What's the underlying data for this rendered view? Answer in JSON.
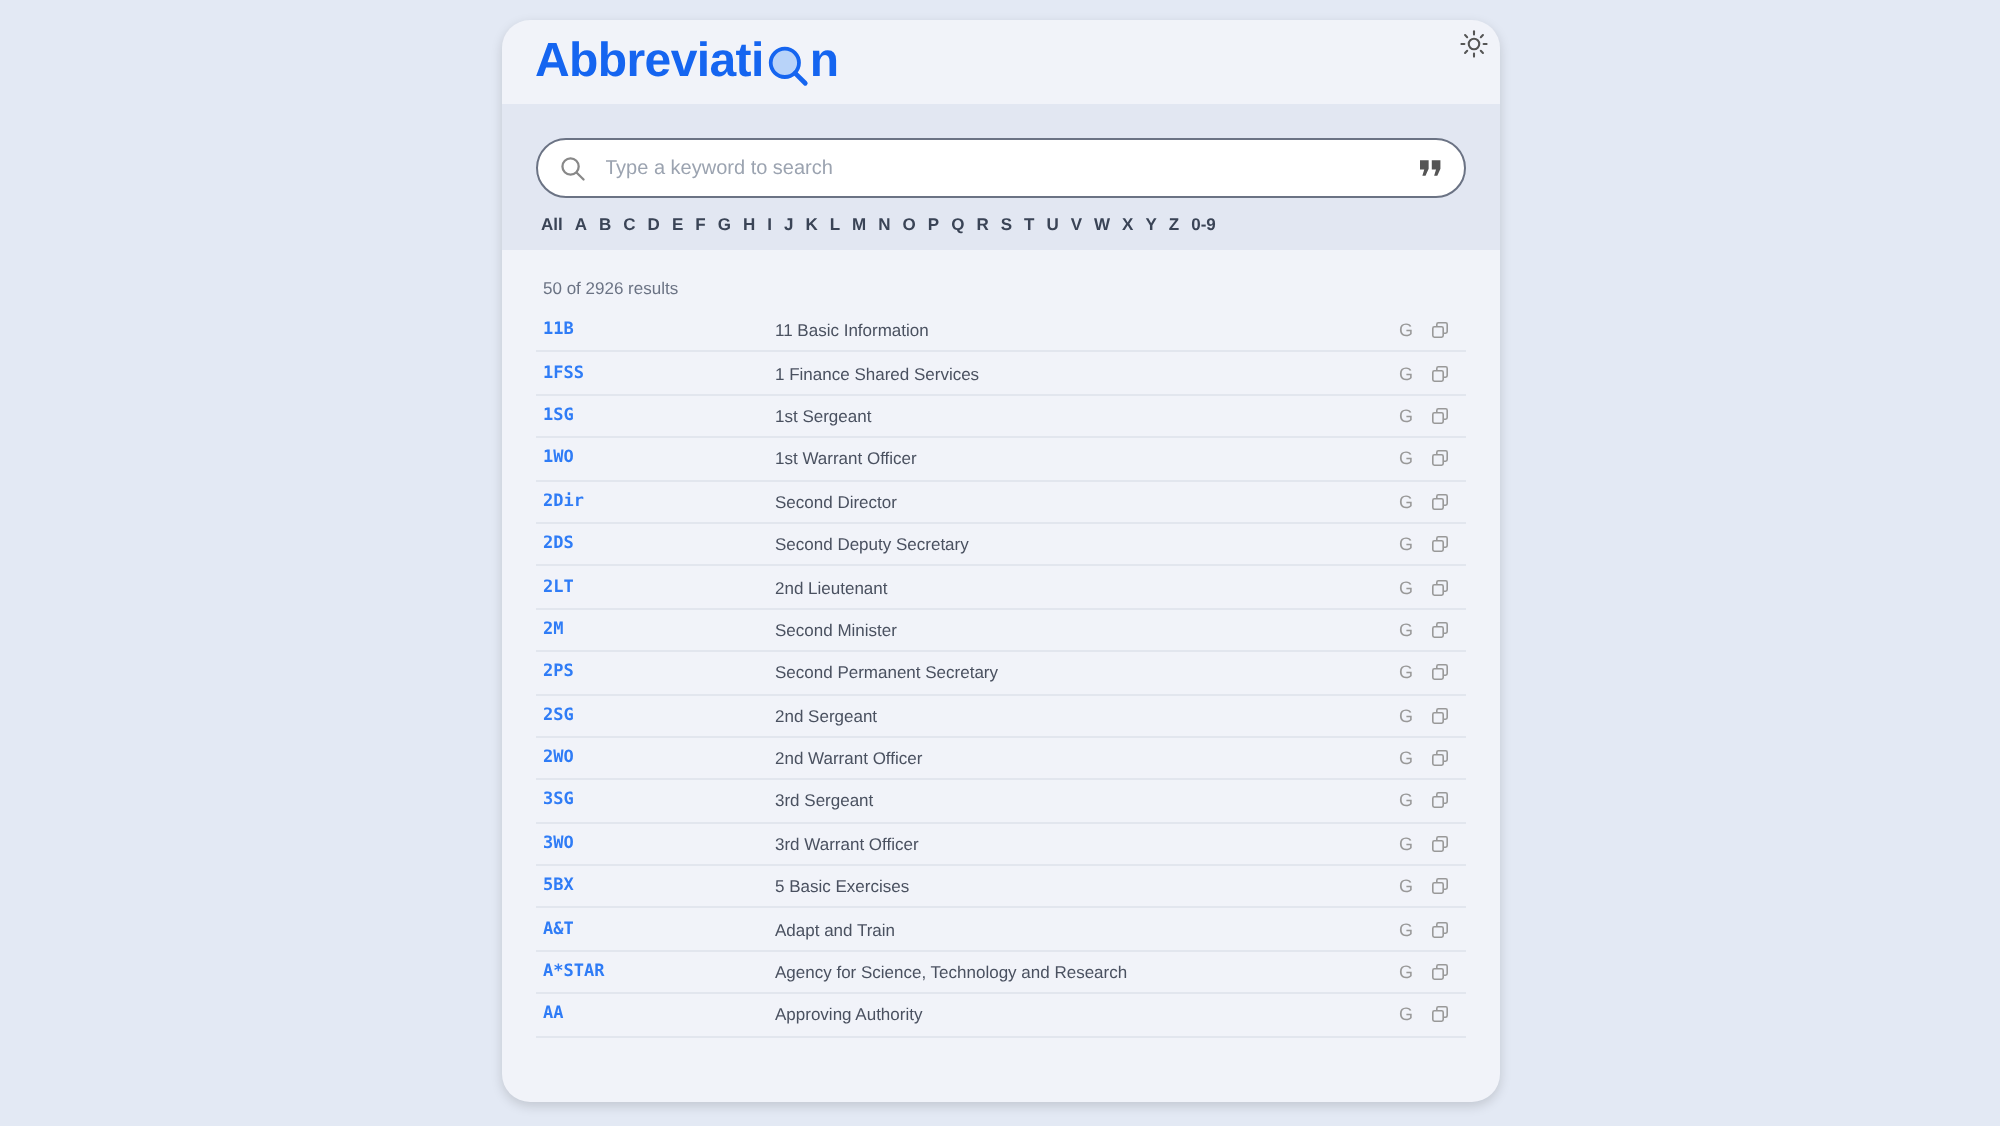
{
  "logo": {
    "start": "Abbreviati",
    "end": "n"
  },
  "search": {
    "placeholder": "Type a keyword to search"
  },
  "letters": [
    "All",
    "A",
    "B",
    "C",
    "D",
    "E",
    "F",
    "G",
    "H",
    "I",
    "J",
    "K",
    "L",
    "M",
    "N",
    "O",
    "P",
    "Q",
    "R",
    "S",
    "T",
    "U",
    "V",
    "W",
    "X",
    "Y",
    "Z",
    "0-9"
  ],
  "result_count": "50 of 2926 results",
  "rows": [
    {
      "abbr": "11B",
      "meaning": "11 Basic Information",
      "search_label": "G"
    },
    {
      "abbr": "1FSS",
      "meaning": "1 Finance Shared Services",
      "search_label": "G"
    },
    {
      "abbr": "1SG",
      "meaning": "1st Sergeant",
      "search_label": "G"
    },
    {
      "abbr": "1WO",
      "meaning": "1st Warrant Officer",
      "search_label": "G"
    },
    {
      "abbr": "2Dir",
      "meaning": "Second Director",
      "search_label": "G"
    },
    {
      "abbr": "2DS",
      "meaning": "Second Deputy Secretary",
      "search_label": "G"
    },
    {
      "abbr": "2LT",
      "meaning": "2nd Lieutenant",
      "search_label": "G"
    },
    {
      "abbr": "2M",
      "meaning": "Second Minister",
      "search_label": "G"
    },
    {
      "abbr": "2PS",
      "meaning": "Second Permanent Secretary",
      "search_label": "G"
    },
    {
      "abbr": "2SG",
      "meaning": "2nd Sergeant",
      "search_label": "G"
    },
    {
      "abbr": "2WO",
      "meaning": "2nd Warrant Officer",
      "search_label": "G"
    },
    {
      "abbr": "3SG",
      "meaning": "3rd Sergeant",
      "search_label": "G"
    },
    {
      "abbr": "3WO",
      "meaning": "3rd Warrant Officer",
      "search_label": "G"
    },
    {
      "abbr": "5BX",
      "meaning": "5 Basic Exercises",
      "search_label": "G"
    },
    {
      "abbr": "A&T",
      "meaning": "Adapt and Train",
      "search_label": "G"
    },
    {
      "abbr": "A*STAR",
      "meaning": "Agency for Science, Technology and Research",
      "search_label": "G"
    },
    {
      "abbr": "AA",
      "meaning": "Approving Authority",
      "search_label": "G"
    }
  ]
}
